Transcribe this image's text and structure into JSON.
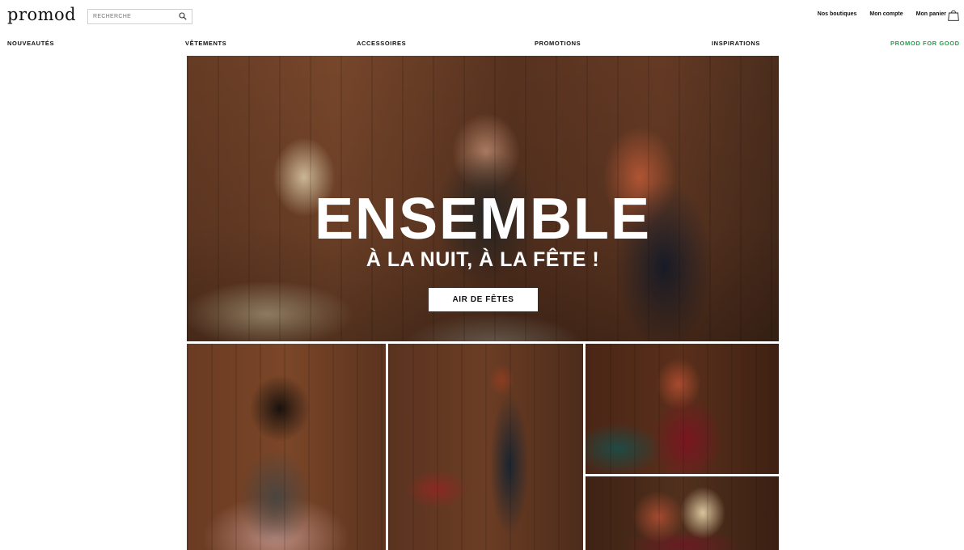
{
  "brand": {
    "logo": "promod"
  },
  "search": {
    "placeholder": "RECHERCHE"
  },
  "top_links": {
    "stores": "Nos boutiques",
    "account": "Mon compte",
    "cart": "Mon panier"
  },
  "main_nav": {
    "items": [
      {
        "label": "NOUVEAUTÉS"
      },
      {
        "label": "VÊTEMENTS"
      },
      {
        "label": "ACCESSOIRES"
      },
      {
        "label": "PROMOTIONS"
      },
      {
        "label": "INSPIRATIONS"
      },
      {
        "label": "PROMOD FOR GOOD"
      }
    ],
    "accent_color": "#1fa34a"
  },
  "hero": {
    "title": "ENSEMBLE",
    "subtitle": "À LA NUIT, À LA FÊTE !",
    "cta": "AIR DE FÊTES"
  },
  "icons": {
    "search": "magnifier-icon",
    "cart": "shopping-bag-icon"
  }
}
